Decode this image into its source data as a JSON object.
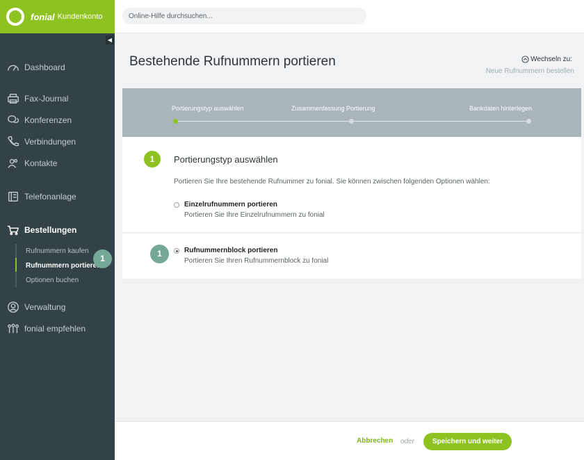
{
  "brand": {
    "name": "fonial",
    "sub": "Kundenkonto"
  },
  "search": {
    "placeholder": "Online-Hilfe durchsuchen..."
  },
  "sidebar": {
    "items": [
      {
        "label": "Dashboard"
      },
      {
        "label": "Fax-Journal"
      },
      {
        "label": "Konferenzen"
      },
      {
        "label": "Verbindungen"
      },
      {
        "label": "Kontakte"
      },
      {
        "label": "Telefonanlage"
      },
      {
        "label": "Bestellungen"
      },
      {
        "label": "Verwaltung"
      },
      {
        "label": "fonial empfehlen"
      }
    ],
    "subitems": [
      {
        "label": "Rufnummern kaufen"
      },
      {
        "label": "Rufnummern portieren"
      },
      {
        "label": "Optionen buchen"
      }
    ],
    "badge": "1"
  },
  "page": {
    "title": "Bestehende Rufnummern portieren",
    "switch_label": "Wechseln zu:",
    "switch_link": "Neue Rufnummern bestellen"
  },
  "stepper": {
    "steps": [
      {
        "label": "Portierungstyp auswählen"
      },
      {
        "label": "Zusammenfassung Portierung"
      },
      {
        "label": "Bankdaten hinterlegen"
      }
    ]
  },
  "section": {
    "number": "1",
    "title": "Portierungstyp auswählen",
    "intro": "Portieren Sie Ihre bestehende Rufnummer zu fonial. Sie können zwischen folgenden Optionen wählen:"
  },
  "options": [
    {
      "title": "Einzelrufnummern portieren",
      "desc": "Portieren Sie Ihre Einzelrufnummern zu fonial",
      "selected": false
    },
    {
      "title": "Rufnummernblock portieren",
      "desc": "Portieren Sie Ihren Rufnummernblock zu fonial",
      "selected": true
    }
  ],
  "option_badge": "1",
  "footer": {
    "cancel": "Abbrechen",
    "or": "oder",
    "save": "Speichern und weiter"
  },
  "colors": {
    "accent": "#8dc220",
    "sidebar": "#334246",
    "stepper": "#a9b5bb",
    "badge": "#76a898"
  }
}
